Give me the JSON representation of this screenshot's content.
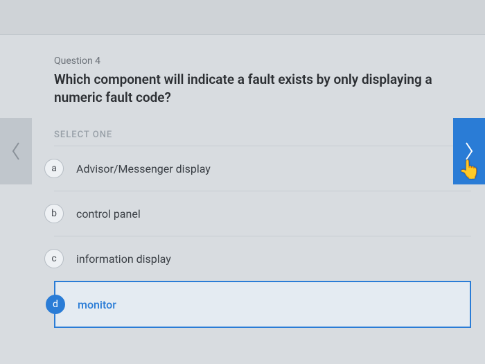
{
  "question": {
    "number_label": "Question 4",
    "text": "Which component will indicate a fault exists by only displaying a numeric fault code?"
  },
  "select_label": "SELECT ONE",
  "options": [
    {
      "letter": "a",
      "text": "Advisor/Messenger display",
      "selected": false
    },
    {
      "letter": "b",
      "text": "control panel",
      "selected": false
    },
    {
      "letter": "c",
      "text": "information display",
      "selected": false
    },
    {
      "letter": "d",
      "text": "monitor",
      "selected": true
    }
  ],
  "colors": {
    "accent": "#2a7cd6"
  }
}
